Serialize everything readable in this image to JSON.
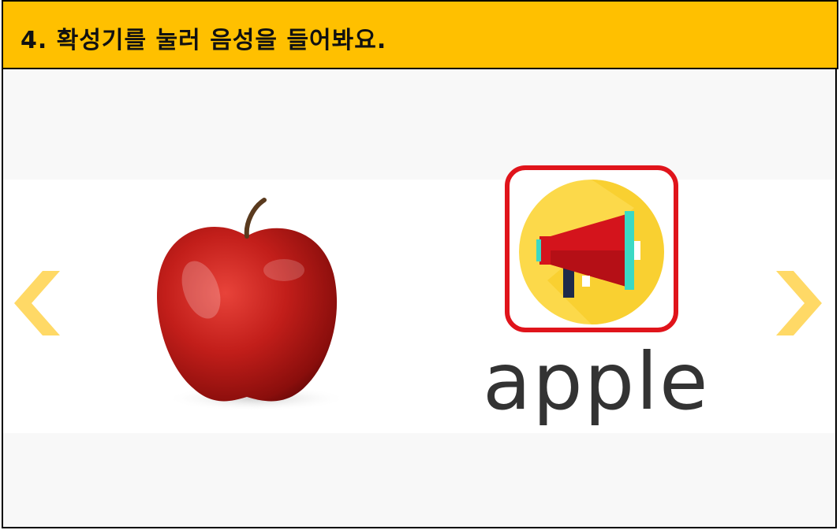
{
  "header": {
    "title": "4. 확성기를 눌러 음성을 들어봐요."
  },
  "card": {
    "word": "apple"
  },
  "icons": {
    "prev": "chevron-left-icon",
    "next": "chevron-right-icon",
    "speaker": "megaphone-icon",
    "image": "apple-image"
  },
  "colors": {
    "header_bg": "#ffc000",
    "chevron": "#ffd966",
    "highlight": "#e0141b",
    "icon_circle": "#fcd94a",
    "megaphone": "#d4141c",
    "accent": "#3ad9c5"
  }
}
